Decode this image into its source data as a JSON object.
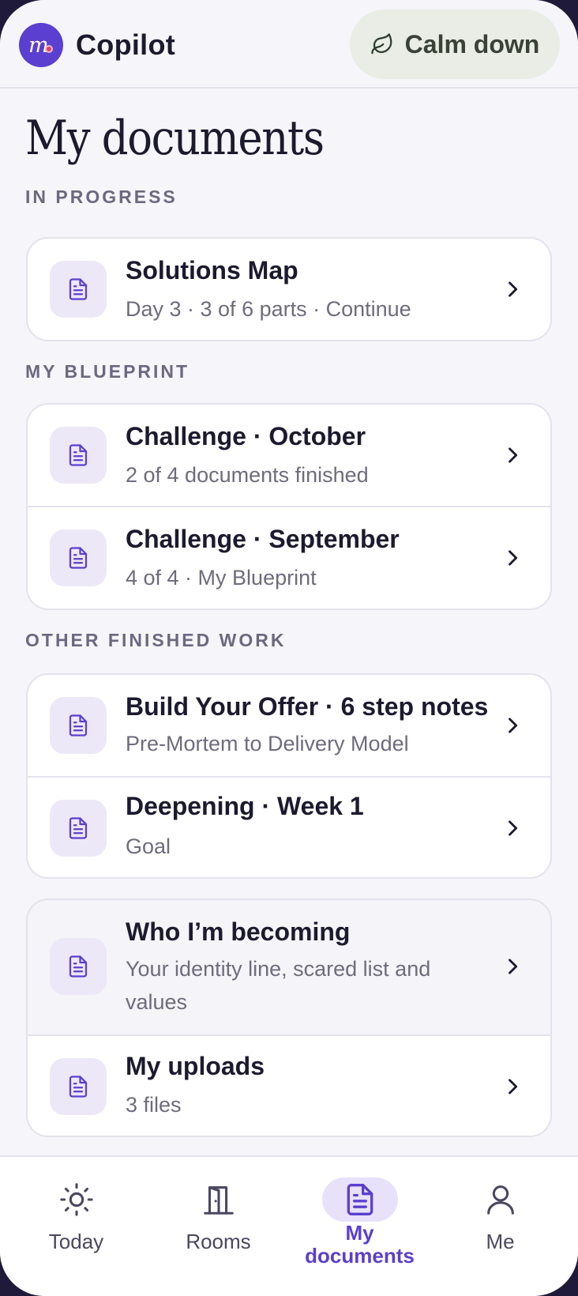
{
  "header": {
    "app_name": "Copilot",
    "calm_button_label": "Calm down"
  },
  "page": {
    "title": "My documents"
  },
  "sections": {
    "in_progress": {
      "label": "IN PROGRESS",
      "items": [
        {
          "title": "Solutions Map",
          "subtitle": "Day 3 · 3 of 6 parts · Continue"
        }
      ]
    },
    "blueprint": {
      "label": "MY BLUEPRINT",
      "items": [
        {
          "title": "Challenge · October",
          "subtitle": "2 of 4 documents finished"
        },
        {
          "title": "Challenge · September",
          "subtitle": "4 of 4 · My Blueprint"
        }
      ]
    },
    "other": {
      "label": "OTHER FINISHED WORK",
      "items": [
        {
          "title": "Build Your Offer · 6 step notes",
          "subtitle": "Pre-Mortem to Delivery Model"
        },
        {
          "title": "Deepening · Week 1",
          "subtitle": "Goal"
        }
      ]
    },
    "personal": {
      "items": [
        {
          "title": "Who I’m becoming",
          "subtitle_line1": "Your identity line, scared list and",
          "subtitle_line2": "values"
        },
        {
          "title": "My uploads",
          "subtitle": "3 files"
        }
      ]
    }
  },
  "nav": {
    "today": "Today",
    "rooms": "Rooms",
    "my_documents_line1": "My",
    "my_documents_line2": "documents",
    "me": "Me",
    "active": "my_documents"
  },
  "colors": {
    "accent": "#5b3fd0",
    "icon_bg": "#ece8f7",
    "calm_bg": "#e9ede6"
  }
}
